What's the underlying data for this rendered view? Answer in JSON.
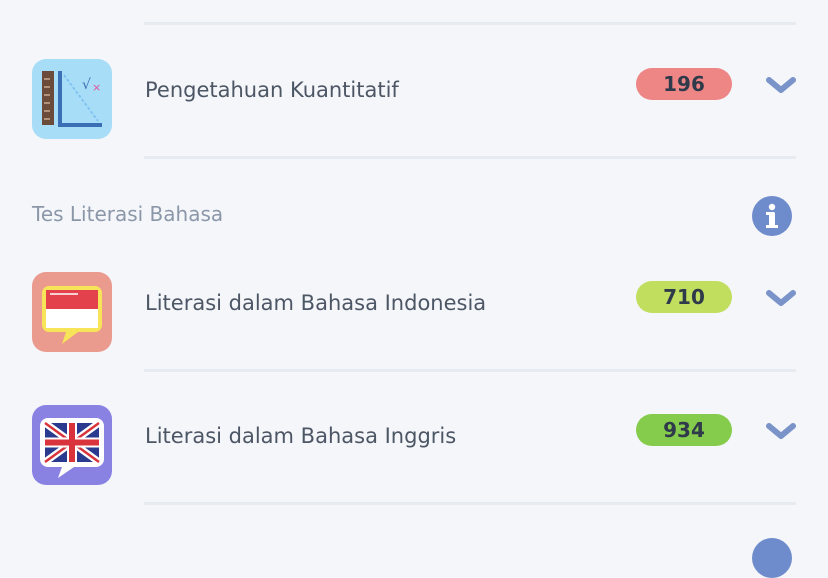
{
  "rows": [
    {
      "label": "Pengetahuan Kuantitatif",
      "score": "196",
      "score_color": "#ee8686",
      "icon": "ruler-math-icon"
    },
    {
      "label": "Literasi dalam Bahasa Indonesia",
      "score": "710",
      "score_color": "#c1de5f",
      "icon": "indonesia-flag-chat-icon"
    },
    {
      "label": "Literasi dalam Bahasa Inggris",
      "score": "934",
      "score_color": "#86cc4c",
      "icon": "uk-flag-chat-icon"
    }
  ],
  "section": {
    "title": "Tes Literasi Bahasa",
    "info_icon": "info-icon"
  },
  "colors": {
    "chevron": "#7a93c8",
    "background": "#f4f6fa",
    "info": "#6e8ccb"
  }
}
